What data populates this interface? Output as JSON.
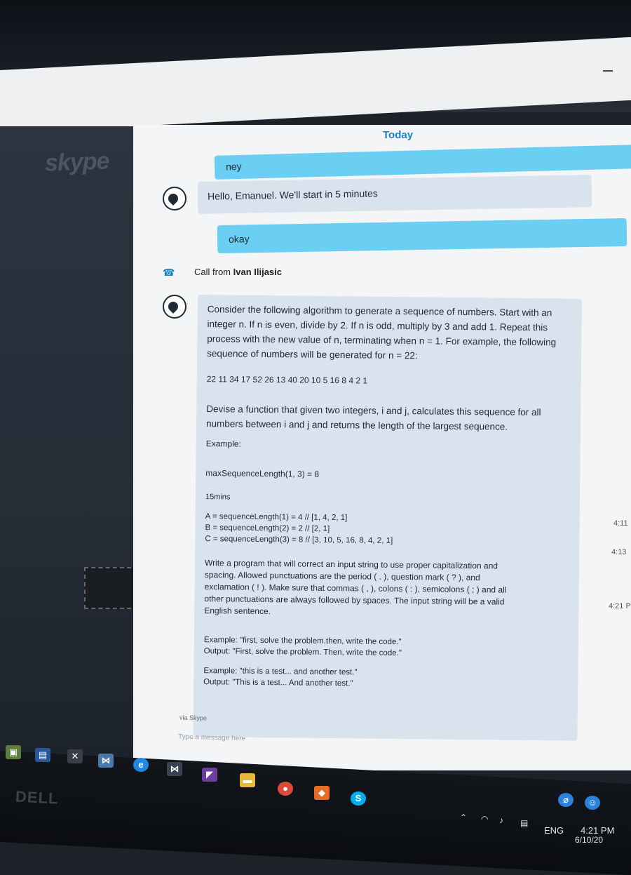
{
  "header": {
    "date_divider": "Today"
  },
  "sidebar": {
    "logo_text": "skype"
  },
  "messages": {
    "m1": "ney",
    "m2": "Hello, Emanuel. We'll start in 5 minutes",
    "m3": "okay",
    "call_prefix": "Call from ",
    "call_name": "Ivan Ilijasic"
  },
  "problem": {
    "intro": "Consider the following algorithm to generate a sequence of numbers. Start with an integer n. If n is even, divide by 2. If n is odd, multiply by 3 and add 1. Repeat this process with the new value of n, terminating when n = 1. For example, the following sequence of numbers will be generated for n = 22:",
    "sequence": "22 11 34 17 52 26 13 40 20 10 5 16 8 4 2 1",
    "devise": "Devise a function that given two integers, i and j, calculates this sequence for all numbers between i and j and returns the length of the largest sequence.",
    "example_label": "Example:",
    "example_call": "maxSequenceLength(1, 3) = 8",
    "duration": "15mins",
    "line_a": "A = sequenceLength(1) = 4 // [1, 4, 2, 1]",
    "line_b": "B = sequenceLength(2) = 2 // [2, 1]",
    "line_c": "C = sequenceLength(3) = 8 // [3, 10, 5, 16, 8, 4, 2, 1]",
    "task2": "Write a program that will correct an input string to use proper capitalization and spacing. Allowed punctuations are the period ( . ), question mark ( ? ), and exclamation ( ! ). Make sure that commas ( , ), colons ( : ), semicolons ( ; ) and all other punctuations are always followed by spaces. The input string will be a valid English sentence.",
    "ex1_in": "Example: \"first, solve the problem.then, write the code.\"",
    "ex1_out": "Output:  \"First, solve the problem. Then, write the code.\"",
    "ex2_in": "Example: \"this is a test... and another test.\"",
    "ex2_out": "Output:  \"This is a test... And another test.\""
  },
  "timestamps": {
    "t1": "4:11",
    "t2": "4:13",
    "t3": "4:21 P"
  },
  "footer": {
    "via": "via Skype",
    "input_placeholder": "Type a message here"
  },
  "taskbar": {
    "monitor_brand": "DELL",
    "language": "ENG",
    "time": "4:21 PM",
    "date": "6/10/20"
  }
}
